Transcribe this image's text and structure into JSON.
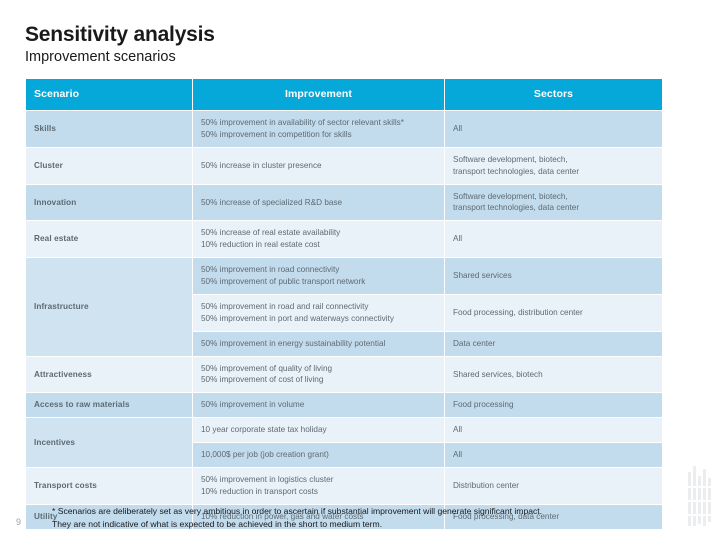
{
  "slide": {
    "title": "Sensitivity analysis",
    "subtitle": "Improvement scenarios",
    "page_number": "9",
    "accent_color": "#05a8d8",
    "row_dark_color": "#c3dced",
    "row_light_color": "#e9f2f8",
    "merged_cell_color": "#cfe3f0"
  },
  "table": {
    "headers": {
      "scenario": "Scenario",
      "improvement": "Improvement",
      "sectors": "Sectors"
    },
    "rows": [
      {
        "scenario": "Skills",
        "shade": "dark",
        "subrows": [
          {
            "improvement_lines": [
              "50% improvement in availability of sector relevant skills*",
              "50% improvement in competition for skills"
            ],
            "sectors": "All",
            "shade": "dark"
          }
        ]
      },
      {
        "scenario": "Cluster",
        "shade": "light",
        "subrows": [
          {
            "improvement_lines": [
              "50% increase in cluster presence"
            ],
            "sectors_lines": [
              "Software development, biotech,",
              "transport technologies, data center"
            ],
            "shade": "light"
          }
        ]
      },
      {
        "scenario": "Innovation",
        "shade": "dark",
        "subrows": [
          {
            "improvement_lines": [
              "50% increase of specialized R&D base"
            ],
            "sectors_lines": [
              "Software development, biotech,",
              "transport technologies, data center"
            ],
            "shade": "dark"
          }
        ]
      },
      {
        "scenario": "Real estate",
        "shade": "light",
        "subrows": [
          {
            "improvement_lines": [
              "50% increase of real estate availability",
              "10% reduction in real estate cost"
            ],
            "sectors": "All",
            "shade": "light"
          }
        ]
      },
      {
        "scenario": "Infrastructure",
        "shade": "mid",
        "subrows": [
          {
            "improvement_lines": [
              "50% improvement in road connectivity",
              "50% improvement of public transport network"
            ],
            "sectors": "Shared services",
            "shade": "dark"
          },
          {
            "improvement_lines": [
              "50% improvement in road and rail connectivity",
              "50% improvement in port and waterways connectivity"
            ],
            "sectors": "Food processing, distribution center",
            "shade": "light"
          },
          {
            "improvement_lines": [
              "50% improvement in energy sustainability potential"
            ],
            "sectors": "Data center",
            "shade": "dark"
          }
        ]
      },
      {
        "scenario": "Attractiveness",
        "shade": "light",
        "subrows": [
          {
            "improvement_lines": [
              "50% improvement of quality of living",
              "50% improvement of cost of living"
            ],
            "sectors": "Shared services, biotech",
            "shade": "light"
          }
        ]
      },
      {
        "scenario": "Access to raw materials",
        "shade": "dark",
        "subrows": [
          {
            "improvement_lines": [
              "50% improvement in volume"
            ],
            "sectors": "Food processing",
            "shade": "dark"
          }
        ]
      },
      {
        "scenario": "Incentives",
        "shade": "mid",
        "subrows": [
          {
            "improvement_lines": [
              "10 year corporate state tax holiday"
            ],
            "sectors": "All",
            "shade": "light"
          },
          {
            "improvement_lines": [
              "10,000$ per job (job creation grant)"
            ],
            "sectors": "All",
            "shade": "dark"
          }
        ]
      },
      {
        "scenario": "Transport costs",
        "shade": "light",
        "subrows": [
          {
            "improvement_lines": [
              "50% improvement in logistics cluster",
              "10% reduction in transport costs"
            ],
            "sectors": "Distribution center",
            "shade": "light"
          }
        ]
      },
      {
        "scenario": "Utility",
        "shade": "dark",
        "subrows": [
          {
            "improvement_lines": [
              "10% reduction in power, gas and water costs"
            ],
            "sectors": "Food processing, data center",
            "shade": "dark"
          }
        ]
      }
    ]
  },
  "footnote": {
    "line1": "* Scenarios are deliberately set as very ambitious in order to ascertain if substantial improvement will generate significant impact.",
    "line2": "They are not indicative of what is expected to be achieved in the short to medium term."
  }
}
